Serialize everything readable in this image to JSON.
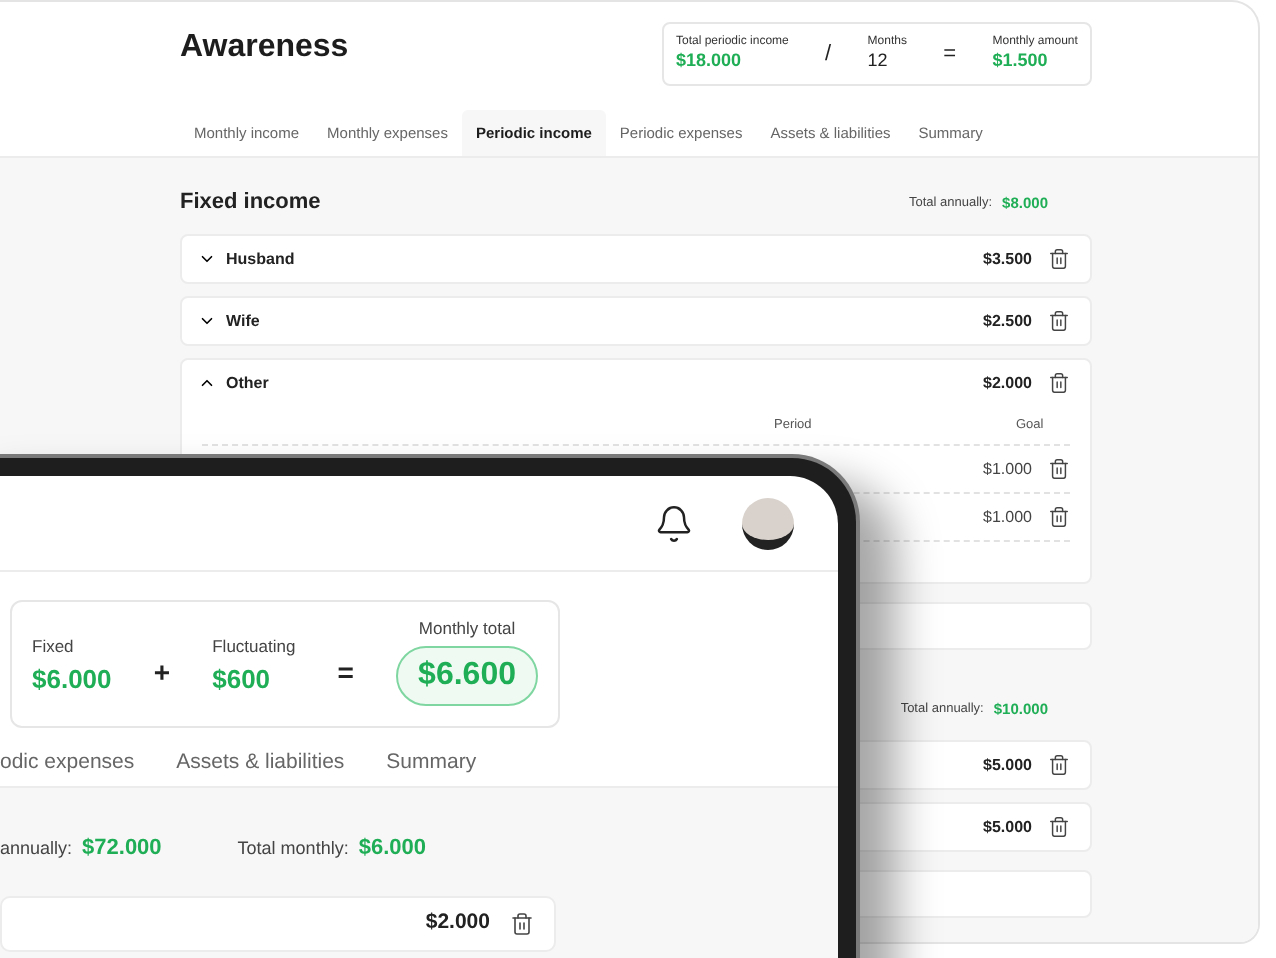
{
  "page": {
    "title": "Awareness",
    "summary": [
      {
        "kind": "value",
        "label": "Total periodic income",
        "value": "$18.000",
        "green": true
      },
      {
        "kind": "operator",
        "symbol": "/"
      },
      {
        "kind": "value",
        "label": "Months",
        "value": "12",
        "green": false
      },
      {
        "kind": "operator",
        "symbol": "="
      },
      {
        "kind": "value",
        "label": "Monthly amount",
        "value": "$1.500",
        "green": true
      }
    ],
    "tabs": [
      {
        "label": "Monthly income",
        "selected": false
      },
      {
        "label": "Monthly expenses",
        "selected": false
      },
      {
        "label": "Periodic income",
        "selected": true
      },
      {
        "label": "Periodic expenses",
        "selected": false
      },
      {
        "label": "Assets & liabilities",
        "selected": false
      },
      {
        "label": "Summary",
        "selected": false
      }
    ],
    "sections": [
      {
        "title": "Fixed income",
        "total_label": "Total annually:",
        "total_value": "$8.000",
        "rows": [
          {
            "name": "Husband",
            "amount": "$3.500",
            "expanded": false
          },
          {
            "name": "Wife",
            "amount": "$2.500",
            "expanded": false
          },
          {
            "name": "Other",
            "amount": "$2.000",
            "expanded": true,
            "columns": [
              "Period",
              "Goal"
            ],
            "entries": [
              {
                "goal": "$1.000"
              },
              {
                "goal": "$1.000"
              }
            ]
          }
        ]
      },
      {
        "total_label": "Total annually:",
        "total_value": "$10.000",
        "rows": [
          {
            "amount": "$5.000"
          },
          {
            "amount": "$5.000"
          }
        ]
      }
    ]
  },
  "tablet": {
    "summary": [
      {
        "kind": "value",
        "label": "Fixed",
        "value": "$6.000"
      },
      {
        "kind": "operator",
        "symbol": "+"
      },
      {
        "kind": "value",
        "label": "Fluctuating",
        "value": "$600"
      },
      {
        "kind": "operator",
        "symbol": "="
      },
      {
        "kind": "total",
        "label": "Monthly total",
        "value": "$6.600"
      }
    ],
    "tabs": [
      {
        "label": "odic expenses",
        "selected": false
      },
      {
        "label": "Assets & liabilities",
        "selected": false
      },
      {
        "label": "Summary",
        "selected": false
      }
    ],
    "totals": [
      {
        "label": "annually:",
        "value": "$72.000"
      },
      {
        "label": "Total monthly:",
        "value": "$6.000"
      }
    ],
    "rows": [
      {
        "amount": "$2.000"
      }
    ]
  }
}
